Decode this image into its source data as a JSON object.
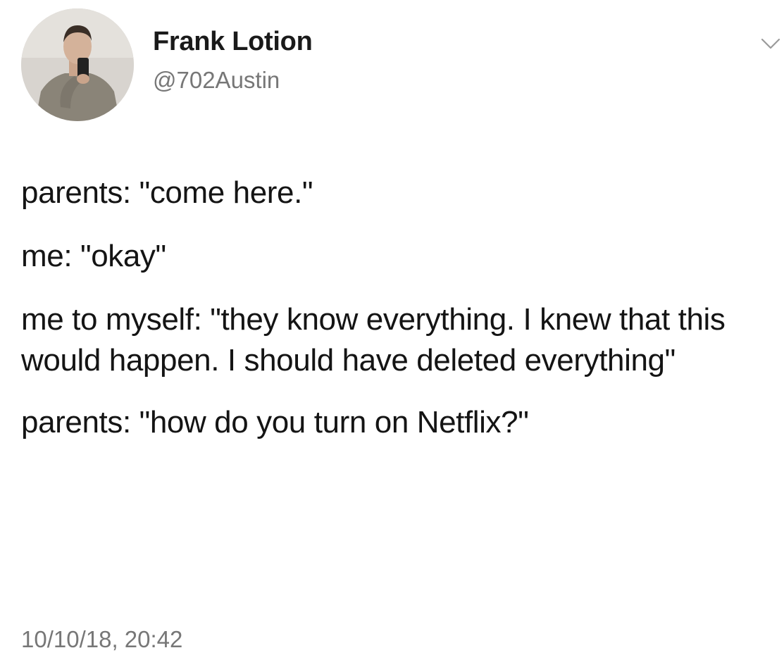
{
  "tweet": {
    "author": {
      "name": "Frank Lotion",
      "handle": "@702Austin",
      "avatar_icon": "profile-photo-mirror-selfie"
    },
    "menu_icon": "chevron-down-icon",
    "body_paragraphs": [
      "parents: \"come here.\"",
      "me: \"okay\"",
      "me to myself: \"they know everything. I knew that this would happen. I should have deleted everything\"",
      "parents: \"how do you turn on Netflix?\""
    ],
    "timestamp": "10/10/18, 20:42"
  },
  "colors": {
    "background": "#ffffff",
    "text_primary": "#141414",
    "text_secondary": "#777777"
  }
}
